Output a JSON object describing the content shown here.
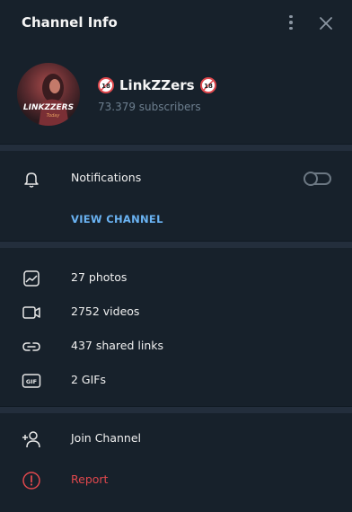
{
  "header": {
    "title": "Channel Info"
  },
  "profile": {
    "name": "LinkZZers",
    "subscribers": "73.379 subscribers",
    "badge": "18"
  },
  "notifications": {
    "label": "Notifications",
    "enabled": false
  },
  "view_channel": {
    "label": "VIEW CHANNEL"
  },
  "media": {
    "photos": "27 photos",
    "videos": "2752 videos",
    "links": "437 shared links",
    "gifs": "2 GIFs"
  },
  "actions": {
    "join": "Join Channel",
    "report": "Report"
  },
  "colors": {
    "bg": "#17212b",
    "accent": "#6ab3f3",
    "danger": "#e0484d",
    "subtext": "#6d7f8f"
  }
}
